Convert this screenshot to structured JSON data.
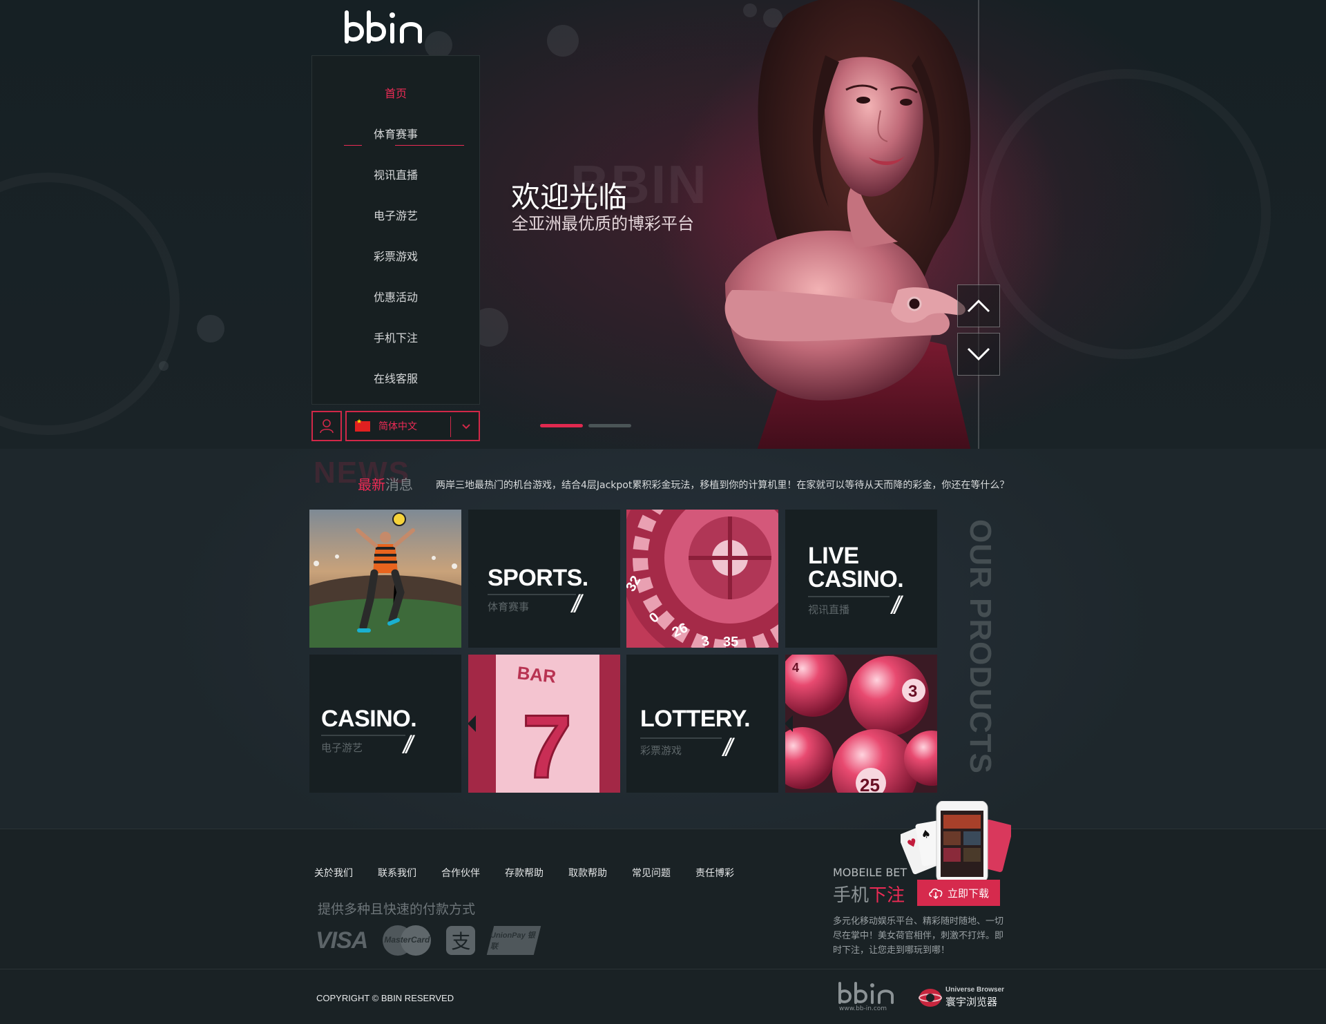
{
  "brand": {
    "logo_text": "bbin",
    "footer_url": "www.bb-in.com"
  },
  "nav": {
    "items": [
      {
        "label": "首页",
        "active": true
      },
      {
        "label": "体育赛事",
        "active": false
      },
      {
        "label": "视讯直播",
        "active": false
      },
      {
        "label": "电子游艺",
        "active": false
      },
      {
        "label": "彩票游戏",
        "active": false
      },
      {
        "label": "优惠活动",
        "active": false
      },
      {
        "label": "手机下注",
        "active": false
      },
      {
        "label": "在线客服",
        "active": false
      }
    ],
    "language": "简体中文"
  },
  "hero": {
    "ghost_text": "BBIN",
    "title": "欢迎光临",
    "subtitle": "全亚洲最优质的博彩平台",
    "slides_total": 2,
    "slide_active": 1
  },
  "news": {
    "ghost": "NEWS",
    "label_hot": "最新",
    "label_rest": "消息",
    "text": "两岸三地最热门的机台游戏，结合4层Jackpot累积彩金玩法，移植到你的计算机里！在家就可以等待从天而降的彩金，你还在等什么？"
  },
  "products": {
    "section_title": "OUR PRODUCTS",
    "tiles": [
      {
        "title_line1": "SPORTS.",
        "title_line2": "",
        "sub": "体育赛事"
      },
      {
        "title_line1": "LIVE",
        "title_line2": "CASINO.",
        "sub": "视讯直播"
      },
      {
        "title_line1": "CASINO.",
        "title_line2": "",
        "sub": "电子游艺"
      },
      {
        "title_line1": "LOTTERY.",
        "title_line2": "",
        "sub": "彩票游戏"
      }
    ],
    "slash": "//"
  },
  "footer": {
    "links": [
      "关於我们",
      "联系我们",
      "合作伙伴",
      "存款帮助",
      "取款帮助",
      "常见问题",
      "责任博彩"
    ],
    "payment_title": "提供多种且快速的付款方式",
    "payments": [
      "VISA",
      "MasterCard",
      "支",
      "UnionPay 银联"
    ],
    "mobile_en": "MOBEILE BET",
    "mobile_cn_a": "手机",
    "mobile_cn_b": "下注",
    "download": "立即下载",
    "mobile_desc": "多元化移动娱乐平台、精彩随时随地、一切尽在掌中！美女荷官相伴，刺激不打烊。即时下注，让您走到哪玩到哪！",
    "copyright": "COPYRIGHT © BBIN RESERVED",
    "browser_en": "Universe Browser",
    "browser_cn": "寰宇浏览器"
  },
  "colors": {
    "accent": "#ec2b55",
    "bg": "#1c2326"
  }
}
